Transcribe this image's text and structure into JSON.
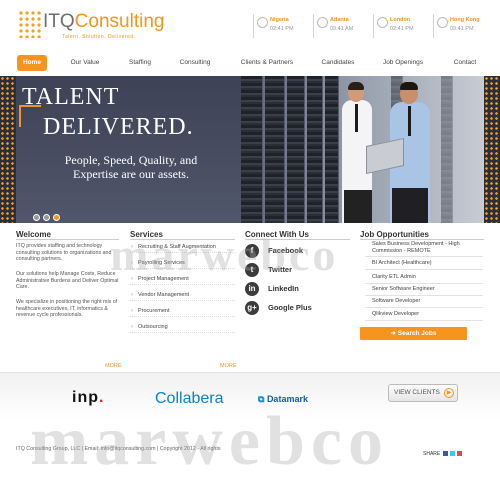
{
  "brand": {
    "itq": "ITQ",
    "consulting": "Consulting",
    "tagline": "Talent. Solution. Delivered."
  },
  "clocks": [
    {
      "city": "Nigeria",
      "time": "02:41 PM"
    },
    {
      "city": "Atlanta",
      "time": "09:41 AM"
    },
    {
      "city": "London",
      "time": "02:41 PM"
    },
    {
      "city": "Hong Kong",
      "time": "09:41 PM"
    }
  ],
  "nav": [
    "Home",
    "Our Value",
    "Staffing",
    "Consulting",
    "Clients & Partners",
    "Candidates",
    "Job Openings",
    "Contact"
  ],
  "hero": {
    "line1": "TALENT",
    "line2": "DELIVERED.",
    "sub": "People, Speed, Quality, and Expertise are our assets."
  },
  "welcome": {
    "heading": "Welcome",
    "p1": "ITQ provides staffing and technology consulting solutions to organizations and consulting partners.",
    "p2": "Our solutions help Manage Costs, Reduce Administrative Burdens and Deliver Optimal Care.",
    "p3": "We specialize in positioning the right mix of healthcare executives, IT, informatics & revenue cycle professionals.",
    "more": "MORE"
  },
  "services": {
    "heading": "Services",
    "items": [
      "Recruiting & Staff Augmentation",
      "Payrolling Services",
      "Project Management",
      "Vendor Management",
      "Procurement",
      "Outsourcing"
    ],
    "more": "MORE"
  },
  "connect": {
    "heading": "Connect With Us",
    "items": [
      {
        "label": "Facebook",
        "glyph": "f"
      },
      {
        "label": "Twitter",
        "glyph": "t"
      },
      {
        "label": "LinkedIn",
        "glyph": "in"
      },
      {
        "label": "Google Plus",
        "glyph": "g+"
      }
    ]
  },
  "jobs": {
    "heading": "Job Opportunities",
    "items": [
      "Sales Business Development - High Commission - REMOTE",
      "BI Architect (Healthcare)",
      "Clarity ETL Admin",
      "Senior Software Engineer",
      "Software Developer",
      "Qlikview Developer"
    ],
    "search": "Search Jobs"
  },
  "clients": {
    "inp": "inp",
    "collabera": "Collabera",
    "datamark": "Datamark",
    "view": "VIEW CLIENTS"
  },
  "footer": {
    "text": "ITQ Consulting Group, LLC | Email: info@itqconsulting.com | Copyright 2012 - All rights",
    "share": "SHARE"
  },
  "watermark": "marwebco",
  "colors": {
    "accent": "#f7941d",
    "hero_dark": "#3d4256"
  }
}
